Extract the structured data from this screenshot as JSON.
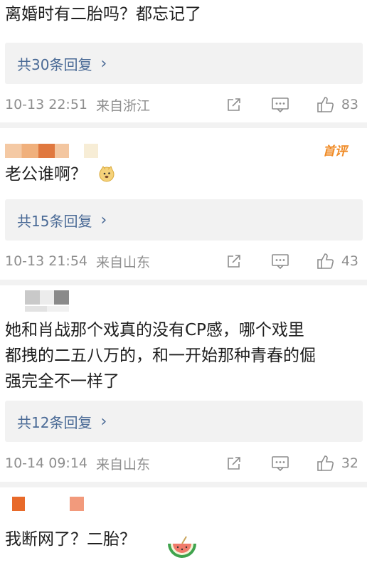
{
  "comments": [
    {
      "text_lines": [
        "离婚时有二胎吗？都忘记了"
      ],
      "reply_label": "共30条回复",
      "time": "10-13 22:51",
      "location": "来自浙江",
      "likes": "83"
    },
    {
      "badge": "首评",
      "text_lines": [
        "老公谁啊？"
      ],
      "emoji": "doge-emoji",
      "reply_label": "共15条回复",
      "time": "10-13 21:54",
      "location": "来自山东",
      "likes": "43"
    },
    {
      "text_lines": [
        "她和肖战那个戏真的没有CP感，哪个戏里",
        "都拽的二五八万的，和一开始那种青春的倔",
        "强完全不一样了"
      ],
      "reply_label": "共12条回复",
      "time": "10-14 09:14",
      "location": "来自山东",
      "likes": "32"
    },
    {
      "text_lines": [
        "我断网了？二胎？"
      ],
      "emoji": "watermelon-emoji"
    }
  ],
  "icons": {
    "share": "share-icon",
    "comment": "comment-icon",
    "like": "thumbs-up-icon",
    "chevron": "chevron-right-icon"
  },
  "colors": {
    "link": "#4a6a96",
    "meta": "#8e8e8e",
    "badge": "#f08a24",
    "reply_bg": "#f2f2f2"
  }
}
